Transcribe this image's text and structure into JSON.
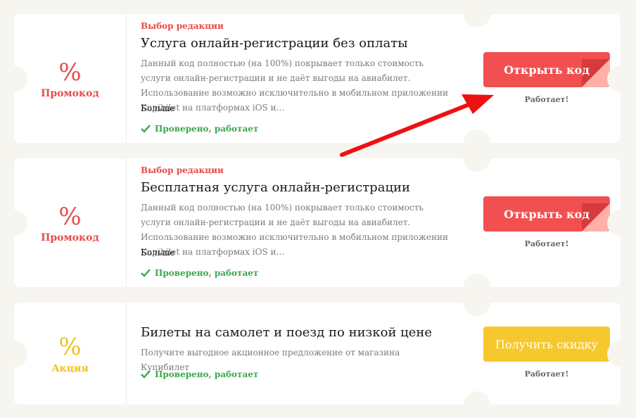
{
  "coupons": [
    {
      "percent": "%",
      "type": "Промокод",
      "label": "Выбор редакции",
      "title": "Услуга онлайн-регистрации без оплаты",
      "description": "Данный код полностью (на 100%) покрывает только стоимость услуги онлайн-регистрации и не даёт выгоды на авиабилет. Использование возможно исключительно в мобильном приложении Kupibilet на платформах iOS и…",
      "more": "Больше",
      "verified": "Проверено, работает",
      "button": "Открыть код",
      "status": "Работает!"
    },
    {
      "percent": "%",
      "type": "Промокод",
      "label": "Выбор редакции",
      "title": "Бесплатная услуга онлайн-регистрации",
      "description": "Данный код полностью (на 100%) покрывает только стоимость услуги онлайн-регистрации и не даёт выгоды на авиабилет. Использование возможно исключительно в мобильном приложении Kupibilet на платформах iOS и…",
      "more": "Больше",
      "verified": "Проверено, работает",
      "button": "Открыть код",
      "status": "Работает!"
    },
    {
      "percent": "%",
      "type": "Акция",
      "title": "Билеты на самолет и поезд по низкой цене",
      "description": "Получите выгодное акционное предложение от магазина Купибилет",
      "verified": "Проверено, работает",
      "button": "Получить скидку",
      "status": "Работает!"
    }
  ],
  "colors": {
    "promo_red": "#e84a4a",
    "deal_yellow": "#f0c21a",
    "verified_green": "#3aa84a",
    "arrow_red": "#ee1111"
  },
  "icons": {
    "check": "check-icon",
    "arrow": "pointer-arrow-icon"
  }
}
